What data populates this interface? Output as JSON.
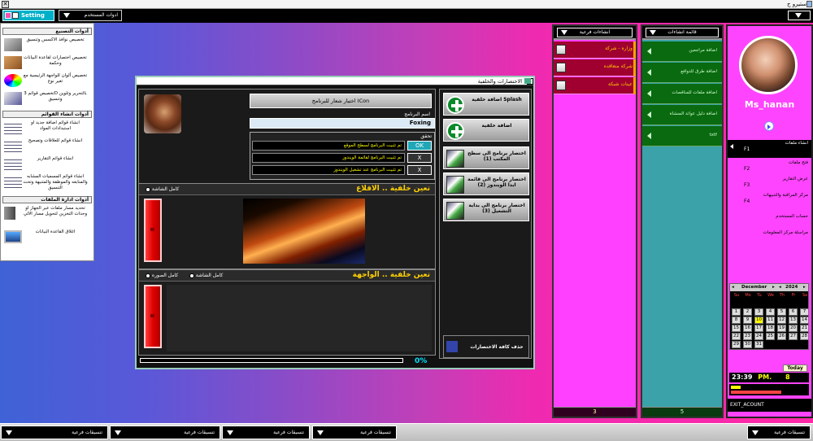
{
  "window": {
    "title": "استيرو ج"
  },
  "topbar": {
    "setting_label": "Setting SyS",
    "tools_label": "ادوات المستخدم"
  },
  "tools_panel": {
    "sections": [
      {
        "title": "أدوات التصنيع",
        "items": [
          {
            "text": "تخصيص نوافذ الاكسس وتنسيق",
            "icon": "windows-icon"
          },
          {
            "text": "تخصيص اختصارات لقاعدة البيانات وحكمة",
            "icon": "tools-icon"
          },
          {
            "text": "تخصيص ألوان للواجهة الرئيسية مع تغير نوع",
            "icon": "palette-icon"
          },
          {
            "text": "تخصيص قوائم 3D بالتحرير وتلوين وتنسيق",
            "icon": "menu3d-icon"
          }
        ]
      },
      {
        "title": "أدوات انشاء القوائم",
        "items": [
          {
            "text": "انشاء قوائم اضافة جديد او استبدادات المواد",
            "icon": "tree-icon"
          },
          {
            "text": "انشاء قوائم للعلاقات وتصحيح",
            "icon": "tree-icon"
          },
          {
            "text": "انشاء قوائم التقارير",
            "icon": "tree-icon"
          },
          {
            "text": "انشاء قوائم المسميات المشابه والمنابعه والموظفة والمتنبهة وتحث التنسيق",
            "icon": "tree-icon"
          }
        ]
      },
      {
        "title": "أدوات ادارة الملفات",
        "items": [
          {
            "text": "تحديد مسار ملفات عبر الجهاز او وحدات التخزين لتحويل مسار الالي",
            "icon": "server-icon"
          },
          {
            "text": "اغلاق القاعدة البيانات",
            "icon": "computer-icon"
          }
        ]
      }
    ]
  },
  "dialog": {
    "title": "الاختصارات والخلفية",
    "choose_icon_label": "اختيار شعار للبرنامج ICon",
    "program_name_label": "اسم البرنامج",
    "program_name_value": "Foxing",
    "verify_label": "تحقق",
    "verify_rows": [
      {
        "text": "تم تثبيت البرنامج لسطح الموقع",
        "state": "OK"
      },
      {
        "text": "تم تثبيت البرنامج لقائمة الويندوز",
        "state": "X"
      },
      {
        "text": "تم تثبيت البرنامج عند تشغيل الويندوز",
        "state": "X"
      }
    ],
    "startup_bg": {
      "title": "تعين خلفية .. الاقلاع",
      "option_full": "كامل الشاشة"
    },
    "front_bg": {
      "title": "تعين خلفية .. الواجهة",
      "option_full": "كامل الشاشة",
      "option_image": "كامل الصوره"
    },
    "progress_percent": "0%",
    "progress_value": 0,
    "actions": [
      {
        "text": "اضافة خلفية Splash",
        "icon": "plus-icon"
      },
      {
        "text": "اضافة خلفية",
        "icon": "plus-icon"
      },
      {
        "text": "اختصار برنامج الى سطح المكتب (1)",
        "icon": "desktop-icon"
      },
      {
        "text": "اختصار برنامج الى قائمة ابدا الويندوز (2)",
        "icon": "start-menu-icon"
      },
      {
        "text": "اختصار برنامج الى بداية التشغيل (3)",
        "icon": "startup-icon"
      }
    ],
    "delete_all_label": "حذف كافة الاختصارات"
  },
  "subtasks_pane": {
    "header": "انشاءات فرعية",
    "rows": [
      "وزاره - شركة",
      "شركة متعاقده",
      "عينات شبكة"
    ],
    "footer": "3",
    "accent": "#a00030"
  },
  "list_pane": {
    "header": "قائمة انشاءات",
    "rows": [
      "اضافة مراجعين",
      "اضافة طرق للدوافع",
      "اضافة ملفات للمناقصات",
      "اضافة دليل عوائد المنشاة",
      "txtf"
    ],
    "footer": "5",
    "accent": "#0a6a10"
  },
  "user_panel": {
    "username": "Ms_hanan",
    "menu": [
      {
        "text": "انشاء ملفات",
        "fkey": "F1",
        "dark": true
      },
      {
        "text": "فتح ملفات",
        "fkey": "F2",
        "dark": false
      },
      {
        "text": "عرض التقارير",
        "fkey": "F3",
        "dark": false
      },
      {
        "text": "مركز المراقبة والتنبيهات",
        "fkey": "F4",
        "dark": false
      },
      {
        "text": "حساب المستخدم",
        "fkey": "",
        "dark": false
      },
      {
        "text": "مراسلة مركز المعلومات",
        "fkey": "",
        "dark": false
      }
    ],
    "calendar": {
      "month": "December",
      "year": "2024",
      "day_names": [
        "Su",
        "Mo",
        "Tu",
        "We",
        "Th",
        "Fr",
        "Sa"
      ],
      "weeks": [
        [
          "",
          "",
          "",
          "",
          "",
          "",
          ""
        ],
        [
          "1",
          "2",
          "3",
          "4",
          "5",
          "6",
          "7"
        ],
        [
          "8",
          "9",
          "10",
          "11",
          "12",
          "13",
          "14"
        ],
        [
          "15",
          "16",
          "17",
          "18",
          "19",
          "20",
          "21"
        ],
        [
          "22",
          "23",
          "24",
          "25",
          "26",
          "27",
          "28"
        ],
        [
          "29",
          "30",
          "31",
          "",
          "",
          "",
          ""
        ]
      ],
      "today": "10"
    },
    "today_label": "Today",
    "time": "23:39",
    "ampm": "PM.",
    "day": "8",
    "exit_label": "EXIT_ACOUNT"
  },
  "taskbar": {
    "items": [
      "تنسيقات فرعية",
      "تنسيقات فرعية",
      "تنسيقات فرعية",
      "تنسيقات فرعية",
      "تنسيقات فرعية"
    ]
  }
}
